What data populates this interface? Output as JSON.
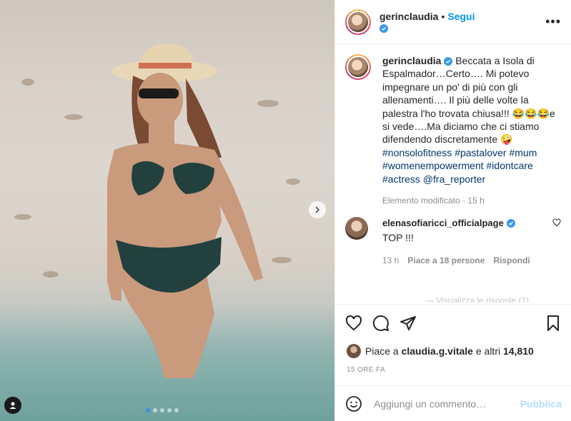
{
  "post": {
    "username": "gerinclaudia",
    "follow_label": "Segui",
    "caption_parts": [
      "Beccata a Isola di Espalmador…Certo…. Mi potevo impegnare un po' di più con gli allenamenti…. Il più delle volte la palestra l'ho trovata chiusa!!! 😂😂😂e si vede….Ma diciamo che ci stiamo difendendo discretamente 🤪",
      "#nonsolofitness",
      "#pastalover",
      "#mum",
      "#womenempowerment",
      "#idontcare",
      "#actress",
      "@fra_reporter"
    ],
    "edited": "Elemento modificato",
    "time_short": "15 h",
    "likes_prefix": "Piace a",
    "likes_user": "claudia.g.vitale",
    "likes_middle": "e altri",
    "likes_count": "14,810",
    "time_ago": "15 ORE FA"
  },
  "comment": {
    "username": "elenasofiaricci_officialpage",
    "text": "TOP !!!",
    "time": "13 h",
    "likes": "Piace a 18 persone",
    "reply": "Rispondi"
  },
  "view_more_replies": "— Visualizza le risposte (1)",
  "composer": {
    "placeholder": "Aggiungi un commento…",
    "publish": "Pubblica"
  },
  "carousel": {
    "count": 5,
    "active": 0
  },
  "colors": {
    "accent": "#0095f6",
    "verified": "#3897f0",
    "publish_disabled": "#b2dffc"
  }
}
